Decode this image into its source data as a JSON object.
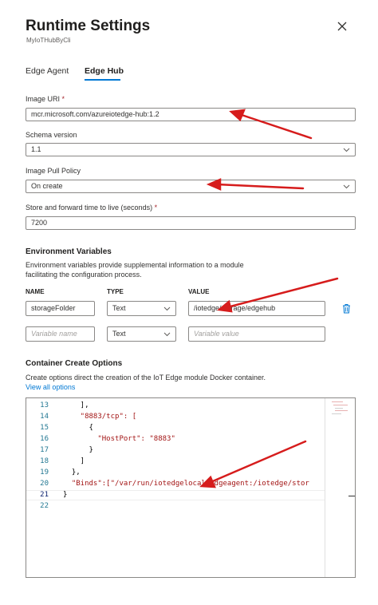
{
  "panel": {
    "title": "Runtime Settings",
    "subtitle": "MyIoTHubByCli",
    "close_icon": "close-icon"
  },
  "tabs": [
    {
      "label": "Edge Agent",
      "active": false
    },
    {
      "label": "Edge Hub",
      "active": true
    }
  ],
  "image_uri": {
    "label": "Image URI",
    "required_mark": "*",
    "value": "mcr.microsoft.com/azureiotedge-hub:1.2"
  },
  "schema_version": {
    "label": "Schema version",
    "value": "1.1"
  },
  "image_pull_policy": {
    "label": "Image Pull Policy",
    "value": "On create"
  },
  "store_forward": {
    "label": "Store and forward time to live (seconds)",
    "required_mark": "*",
    "value": "7200"
  },
  "env_vars": {
    "heading": "Environment Variables",
    "description_line1": "Environment variables provide supplemental information to a module",
    "description_line2": "facilitating the configuration process.",
    "columns": {
      "name": "NAME",
      "type": "TYPE",
      "value": "VALUE"
    },
    "rows": [
      {
        "name": "storageFolder",
        "type": "Text",
        "value": "/iotedge/storage/edgehub"
      }
    ],
    "new_row": {
      "name_placeholder": "Variable name",
      "type": "Text",
      "value_placeholder": "Variable value"
    },
    "delete_icon": "trash-icon"
  },
  "create_options": {
    "heading": "Container Create Options",
    "description": "Create options direct the creation of the IoT Edge module Docker container.",
    "link": "View all options",
    "lines": [
      {
        "num": "13",
        "text": "    ],"
      },
      {
        "num": "14",
        "text": "    \"8883/tcp\": ["
      },
      {
        "num": "15",
        "text": "      {"
      },
      {
        "num": "16",
        "text": "        \"HostPort\": \"8883\""
      },
      {
        "num": "17",
        "text": "      }"
      },
      {
        "num": "18",
        "text": "    ]"
      },
      {
        "num": "19",
        "text": "  },"
      },
      {
        "num": "20",
        "text": "  \"Binds\":[\"/var/run/iotedgelocal/edgeagent:/iotedge/stor"
      },
      {
        "num": "21",
        "text": "}"
      },
      {
        "num": "22",
        "text": ""
      }
    ]
  },
  "colors": {
    "accent": "#0078d4",
    "annotation_arrow": "#d61c1c",
    "string": "#a31515",
    "line_number": "#237893"
  }
}
